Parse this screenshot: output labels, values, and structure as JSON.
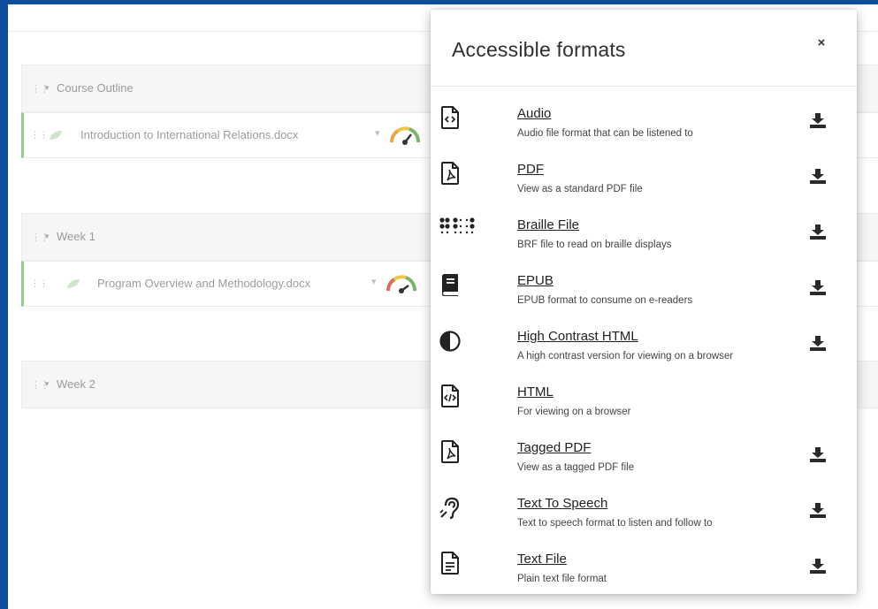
{
  "background_sections": [
    {
      "title": "Course Outline",
      "item": "Introduction to International Relations.docx"
    },
    {
      "title": "Week 1",
      "item": "Program Overview and Methodology.docx"
    },
    {
      "title": "Week 2"
    }
  ],
  "panel": {
    "title": "Accessible formats",
    "close_label": "×"
  },
  "formats": [
    {
      "label": "Audio",
      "description": "Audio file format that can be listened to",
      "icon": "audio-file-icon",
      "download": true
    },
    {
      "label": "PDF",
      "description": "View as a standard PDF file",
      "icon": "pdf-file-icon",
      "download": true
    },
    {
      "label": "Braille File",
      "description": "BRF file to read on braille displays",
      "icon": "braille-icon",
      "download": true
    },
    {
      "label": "EPUB",
      "description": "EPUB format to consume on e-readers",
      "icon": "book-icon",
      "download": true
    },
    {
      "label": "High Contrast HTML",
      "description": "A high contrast version for viewing on a browser",
      "icon": "contrast-icon",
      "download": true
    },
    {
      "label": "HTML",
      "description": "For viewing on a browser",
      "icon": "html-file-icon",
      "download": false
    },
    {
      "label": "Tagged PDF",
      "description": "View as a tagged PDF file",
      "icon": "pdf-file-icon",
      "download": true
    },
    {
      "label": "Text To Speech",
      "description": "Text to speech format to listen and follow to",
      "icon": "hearing-icon",
      "download": true
    },
    {
      "label": "Text File",
      "description": "Plain text file format",
      "icon": "text-file-icon",
      "download": true
    }
  ]
}
